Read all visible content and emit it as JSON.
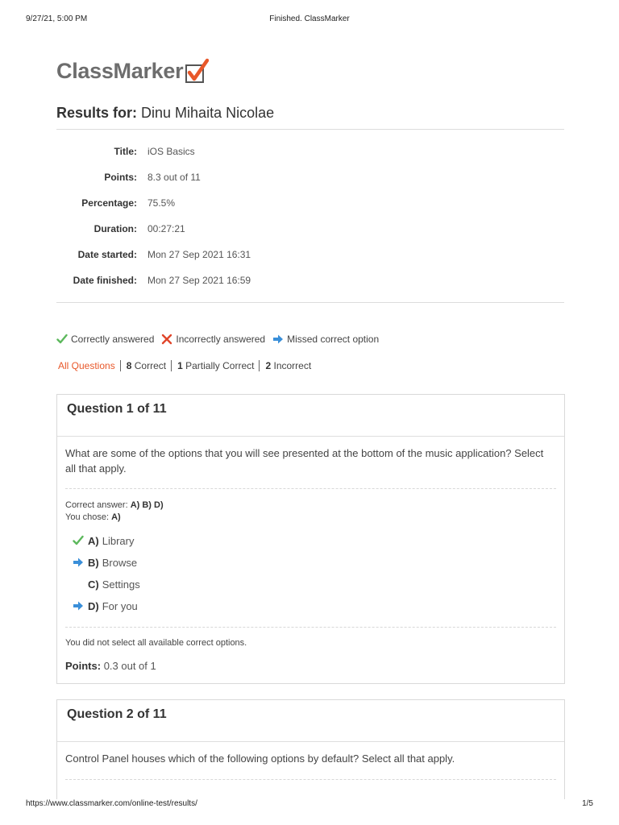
{
  "print": {
    "date": "9/27/21, 5:00 PM",
    "title": "Finished. ClassMarker",
    "url": "https://www.classmarker.com/online-test/results/",
    "page": "1/5"
  },
  "brand": {
    "name": "ClassMarker",
    "check_color": "#e8582a"
  },
  "results": {
    "label": "Results for:",
    "name": "Dinu Mihaita Nicolae",
    "rows": [
      {
        "key": "Title:",
        "value": "iOS Basics"
      },
      {
        "key": "Points:",
        "value": "8.3 out of 11"
      },
      {
        "key": "Percentage:",
        "value": "75.5%"
      },
      {
        "key": "Duration:",
        "value": "00:27:21"
      },
      {
        "key": "Date started:",
        "value": "Mon 27 Sep 2021 16:31"
      },
      {
        "key": "Date finished:",
        "value": "Mon 27 Sep 2021 16:59"
      }
    ]
  },
  "legend": {
    "correct": "Correctly answered",
    "incorrect": "Incorrectly answered",
    "missed": "Missed correct option",
    "colors": {
      "correct": "#5cb85c",
      "incorrect": "#e0452a",
      "missed": "#3a8fd9"
    }
  },
  "filters": {
    "all": "All Questions",
    "correct_count": "8",
    "correct_label": "Correct",
    "partial_count": "1",
    "partial_label": "Partially Correct",
    "incorrect_count": "2",
    "incorrect_label": "Incorrect"
  },
  "questions": [
    {
      "heading": "Question 1 of 11",
      "text": "What are some of the options that you will see presented at the bottom of the music application?  Select all that apply.",
      "correct_answer_label": "Correct answer:",
      "correct_answer": "A) B) D)",
      "you_chose_label": "You chose:",
      "you_chose": "A)",
      "options": [
        {
          "letter": "A)",
          "text": "Library",
          "icon": "check-icon"
        },
        {
          "letter": "B)",
          "text": "Browse",
          "icon": "arrow-right-icon"
        },
        {
          "letter": "C)",
          "text": "Settings",
          "icon": ""
        },
        {
          "letter": "D)",
          "text": "For you",
          "icon": "arrow-right-icon"
        }
      ],
      "feedback": "You did not select all available correct options.",
      "points_label": "Points:",
      "points": "0.3 out of 1"
    },
    {
      "heading": "Question 2 of 11",
      "text": "Control Panel houses which of the following options by default?  Select all that apply."
    }
  ]
}
